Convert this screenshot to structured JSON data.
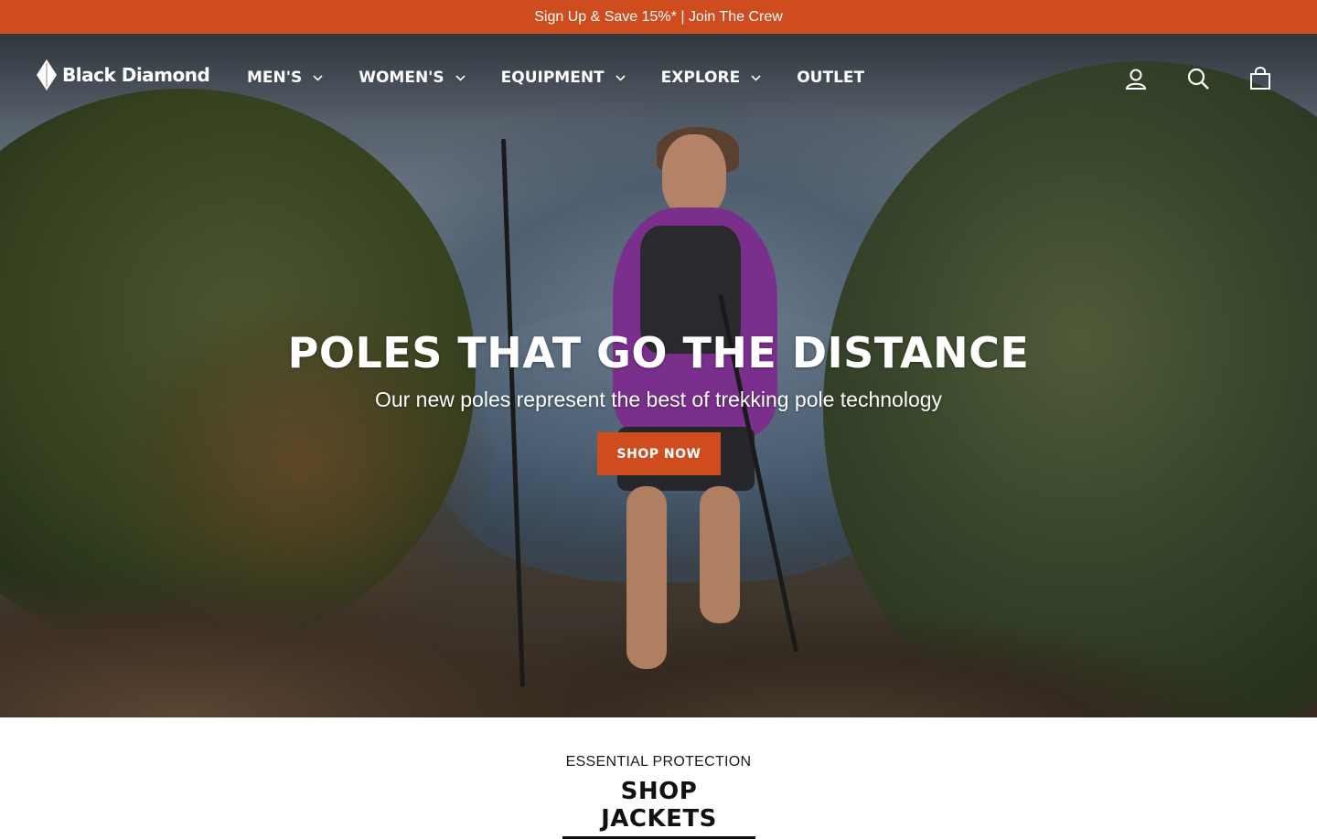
{
  "announcement": {
    "text": "Sign Up & Save 15%* | Join The Crew"
  },
  "brand": {
    "name": "Black Diamond",
    "logo_icon": "diamond-logo-icon"
  },
  "nav": {
    "items": [
      {
        "label": "MEN'S",
        "has_dropdown": true
      },
      {
        "label": "WOMEN'S",
        "has_dropdown": true
      },
      {
        "label": "EQUIPMENT",
        "has_dropdown": true
      },
      {
        "label": "EXPLORE",
        "has_dropdown": true
      },
      {
        "label": "OUTLET",
        "has_dropdown": false
      }
    ]
  },
  "utility_icons": [
    "account-icon",
    "search-icon",
    "cart-icon"
  ],
  "hero": {
    "title": "POLES THAT GO THE DISTANCE",
    "subtitle": "Our new poles represent the best of trekking pole technology",
    "cta_label": "SHOP NOW"
  },
  "section": {
    "eyebrow": "ESSENTIAL PROTECTION",
    "link_label": "SHOP JACKETS"
  },
  "colors": {
    "accent": "#cf4c1e",
    "text_dark": "#111111",
    "white": "#ffffff"
  }
}
